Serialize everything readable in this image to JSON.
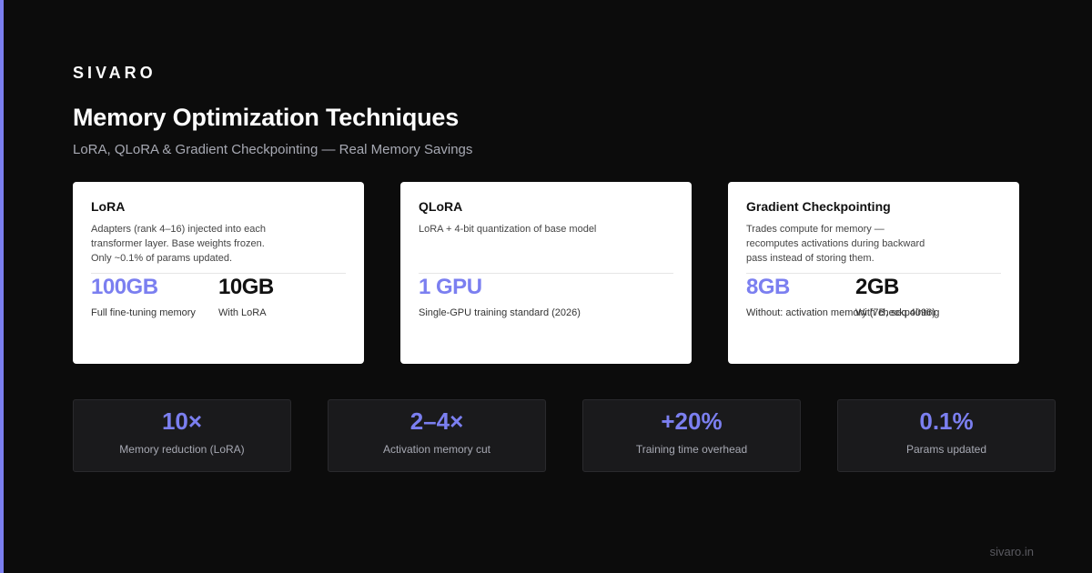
{
  "brand": "SIVARO",
  "title": "Memory Optimization Techniques",
  "subtitle": "LoRA, QLoRA & Gradient Checkpointing — Real Memory Savings",
  "colors": {
    "accent": "#7b7ff0",
    "background": "#0c0c0c",
    "card": "#ffffff",
    "metric_bg": "#1a1a1c"
  },
  "cards": [
    {
      "title": "LoRA",
      "description": "Adapters (rank 4–16) injected into each transformer layer. Base weights frozen. Only ~0.1% of params updated.",
      "stats": [
        {
          "value": "100GB",
          "label": "Full fine-tuning memory"
        },
        {
          "value": "10GB",
          "label": "With LoRA"
        }
      ]
    },
    {
      "title": "QLoRA",
      "description": "LoRA + 4-bit quantization of base model",
      "stats": [
        {
          "value": "1 GPU",
          "label": "Single-GPU training standard (2026)"
        }
      ]
    },
    {
      "title": "Gradient Checkpointing",
      "description": "Trades compute for memory — recomputes activations during backward pass instead of storing them.",
      "stats": [
        {
          "value": "8GB",
          "label": "Without: activation memory (7B, seq 4096)"
        },
        {
          "value": "2GB",
          "label": "With checkpointing"
        }
      ]
    }
  ],
  "metrics": [
    {
      "value": "10×",
      "label": "Memory reduction (LoRA)"
    },
    {
      "value": "2–4×",
      "label": "Activation memory cut"
    },
    {
      "value": "+20%",
      "label": "Training time overhead"
    },
    {
      "value": "0.1%",
      "label": "Params updated"
    }
  ],
  "footer": "sivaro.in"
}
